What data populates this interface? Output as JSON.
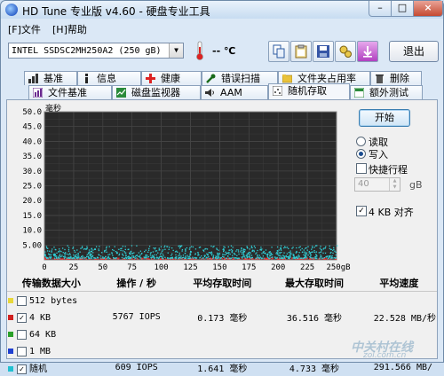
{
  "window": {
    "title": "HD Tune 专业版 v4.60 - 硬盘专业工具",
    "minimize": "–",
    "maximize": "□",
    "close": "×"
  },
  "menu": [
    "[F]文件",
    "[H]帮助"
  ],
  "toolbar": {
    "drive": "INTEL SSDSC2MH250A2 (250 gB)",
    "temperature": "-- ℃",
    "exit_label": "退出"
  },
  "tabs_top": [
    "基准",
    "信息",
    "健康",
    "错误扫描",
    "文件夹占用率",
    "删除"
  ],
  "tabs_bottom": [
    "文件基准",
    "磁盘监视器",
    "AAM",
    "随机存取",
    "额外测试"
  ],
  "active_tab": "随机存取",
  "controls": {
    "start_label": "开始",
    "read_label": "读取",
    "write_label": "写入",
    "selected_mode": "写入",
    "quick_travel_label": "快捷行程",
    "quick_travel_checked": false,
    "travel_value": "40",
    "travel_unit": "gB",
    "align_label": "4 KB 对齐",
    "align_checked": true
  },
  "chart_data": {
    "type": "scatter",
    "ylabel": "毫秒",
    "xlabel": "",
    "x_unit": "gB",
    "xlim": [
      0,
      250
    ],
    "ylim": [
      0,
      50
    ],
    "x_ticks": [
      0,
      25,
      50,
      75,
      100,
      125,
      150,
      175,
      200,
      225,
      250
    ],
    "x_tick_labels": [
      "0",
      "25",
      "50",
      "75",
      "100",
      "125",
      "150",
      "175",
      "200",
      "225",
      "250gB"
    ],
    "y_ticks": [
      0,
      5,
      10,
      15,
      20,
      25,
      30,
      35,
      40,
      45,
      50
    ],
    "y_tick_labels": [
      "",
      "5.00",
      "10.0",
      "15.0",
      "20.0",
      "25.0",
      "30.0",
      "35.0",
      "40.0",
      "45.0",
      "50.0"
    ],
    "grid": true,
    "background": "#2a2a2a",
    "series": [
      {
        "name": "4 KB",
        "color": "#e03030",
        "y_range": [
          0.1,
          0.5
        ]
      },
      {
        "name": "随机",
        "color": "#30d0d8",
        "y_range": [
          0.4,
          4.7
        ]
      }
    ]
  },
  "table": {
    "headers": [
      "传输数据大小",
      "操作 / 秒",
      "平均存取时间",
      "最大存取时间",
      "平均速度"
    ],
    "rows": [
      {
        "color": "#e8d83a",
        "checked": false,
        "size": "512 bytes",
        "ops": "",
        "avg": "",
        "max": "",
        "speed": ""
      },
      {
        "color": "#d02020",
        "checked": true,
        "size": "4 KB",
        "ops": "5767 IOPS",
        "avg": "0.173 毫秒",
        "max": "36.516 毫秒",
        "speed": "22.528 MB/秒"
      },
      {
        "color": "#2aa02a",
        "checked": false,
        "size": "64 KB",
        "ops": "",
        "avg": "",
        "max": "",
        "speed": ""
      },
      {
        "color": "#2040d0",
        "checked": false,
        "size": "1 MB",
        "ops": "",
        "avg": "",
        "max": "",
        "speed": ""
      },
      {
        "color": "#20c0d0",
        "checked": true,
        "size": "随机",
        "ops": "609 IOPS",
        "avg": "1.641 毫秒",
        "max": "4.733 毫秒",
        "speed": "291.566 MB/"
      }
    ]
  },
  "watermark": {
    "brand": "中关村在线",
    "site": "zol.com.cn"
  }
}
